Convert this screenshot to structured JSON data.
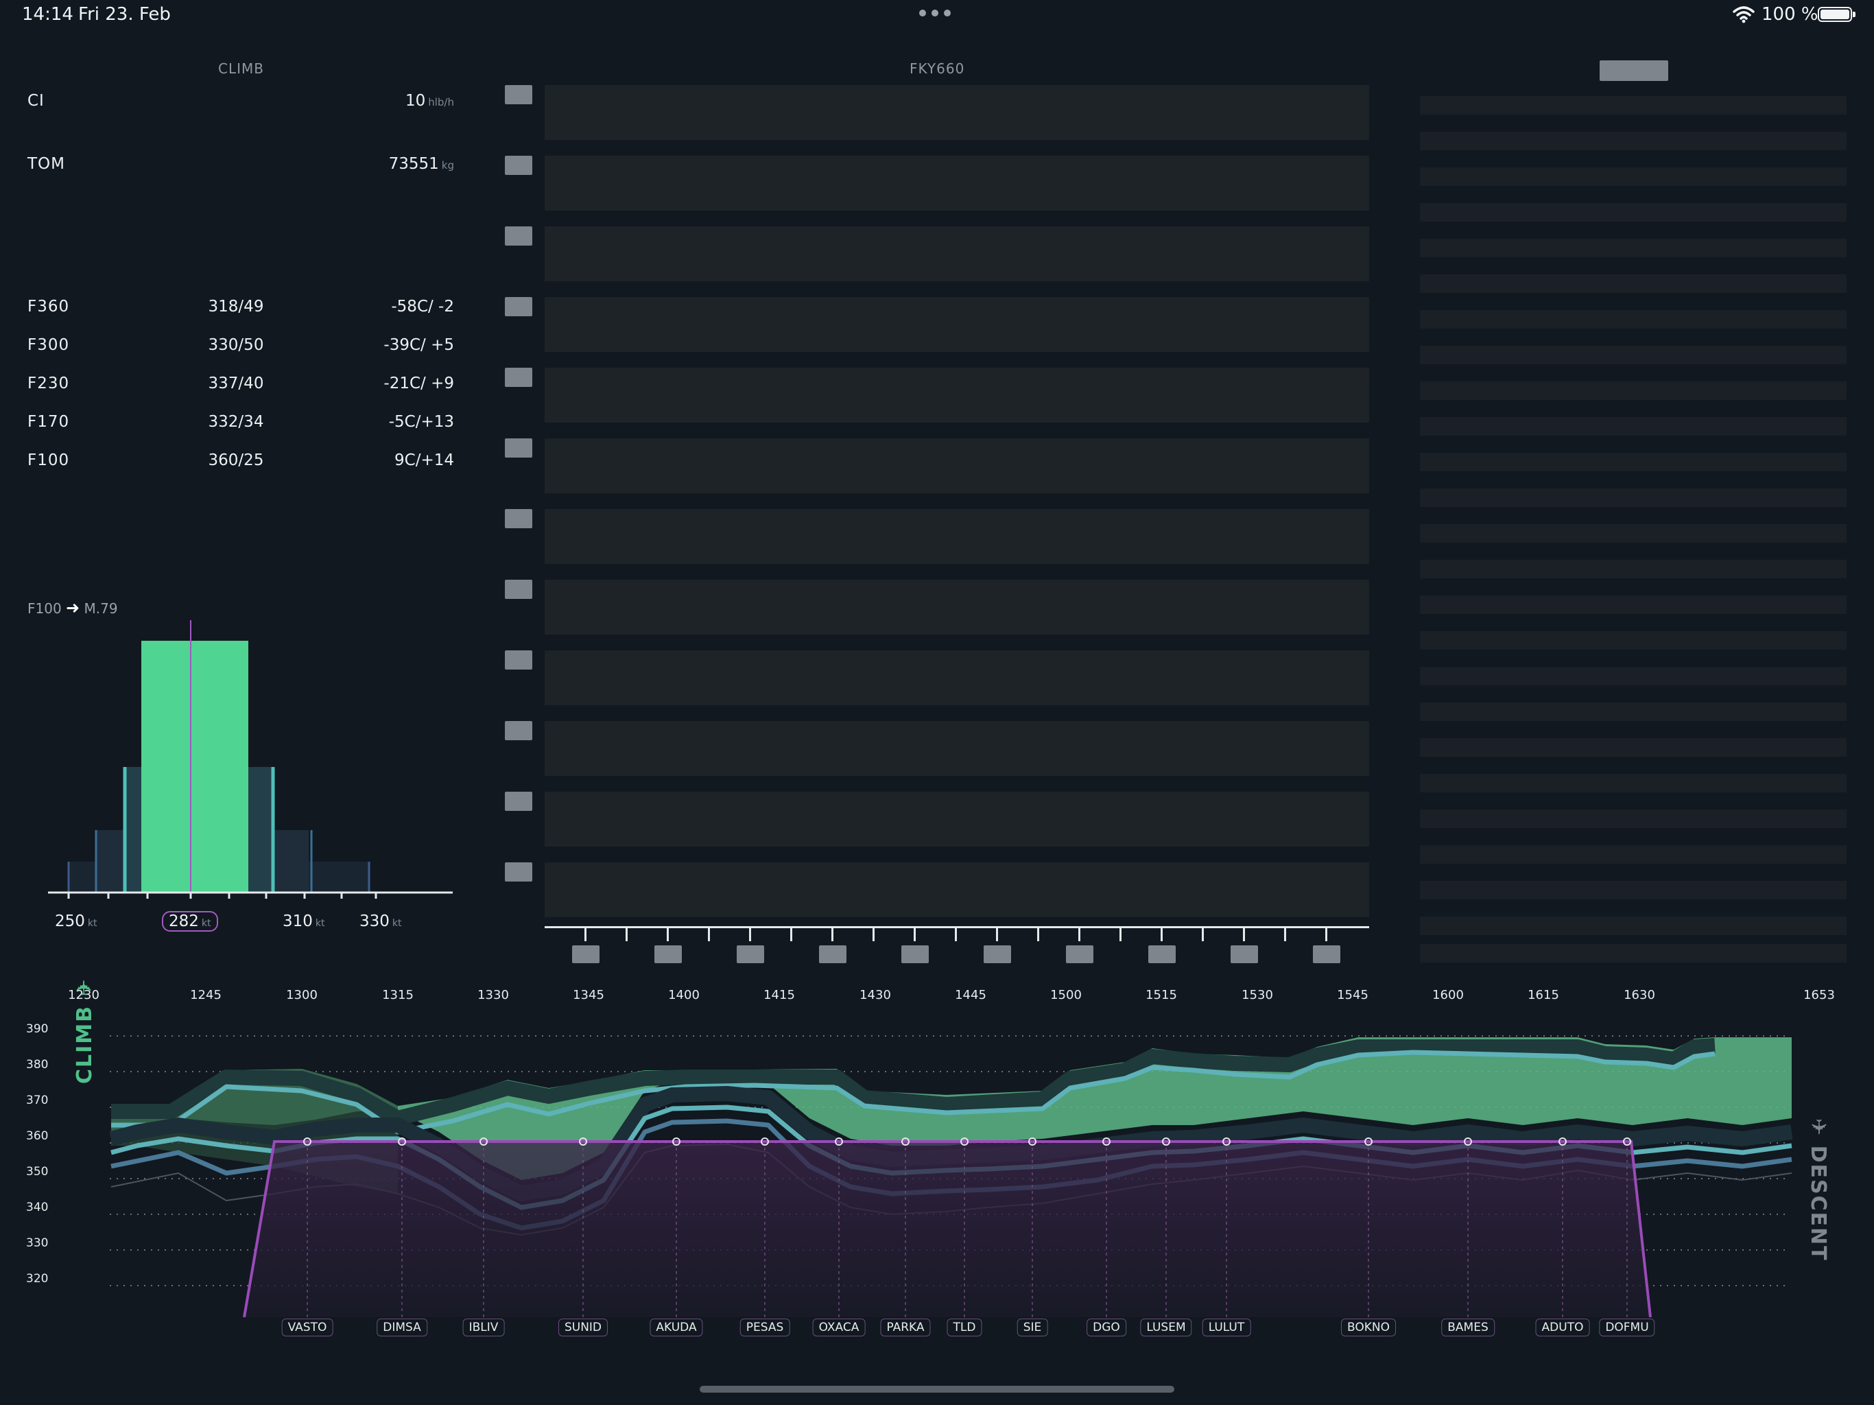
{
  "status_bar": {
    "time": "14:14",
    "date": "Fri 23. Feb",
    "battery": "100 %"
  },
  "climb_panel": {
    "title": "CLIMB",
    "ci": {
      "label": "CI",
      "value": "10",
      "unit": "hlb/h"
    },
    "tom": {
      "label": "TOM",
      "value": "73551",
      "unit": "kg"
    },
    "levels": [
      {
        "fl": "F360",
        "wind": "318/49",
        "temp": "-58C/  -2"
      },
      {
        "fl": "F300",
        "wind": "330/50",
        "temp": "-39C/  +5"
      },
      {
        "fl": "F230",
        "wind": "337/40",
        "temp": "-21C/  +9"
      },
      {
        "fl": "F170",
        "wind": "332/34",
        "temp": "-5C/+13"
      },
      {
        "fl": "F100",
        "wind": "360/25",
        "temp": "9C/+14"
      }
    ],
    "speed_chart": {
      "header_from": "F100",
      "header_to": "M.79",
      "speed_labels": [
        {
          "value": "250",
          "unit": "kt"
        },
        {
          "value": "282",
          "unit": "kt",
          "selected": true
        },
        {
          "value": "310",
          "unit": "kt"
        },
        {
          "value": "330",
          "unit": "kt"
        }
      ]
    }
  },
  "center_panel": {
    "title": "FKY660"
  },
  "timeline": {
    "times": [
      "1230",
      "1245",
      "1300",
      "1315",
      "1330",
      "1345",
      "1400",
      "1415",
      "1430",
      "1445",
      "1500",
      "1515",
      "1530",
      "1545",
      "1600",
      "1615",
      "1630",
      "1653"
    ],
    "flight_levels": [
      "390",
      "380",
      "370",
      "360",
      "350",
      "340",
      "330",
      "320"
    ],
    "climb_label": "CLIMB",
    "descent_label": "DESCENT",
    "waypoints": [
      "VASTO",
      "DIMSA",
      "IBLIV",
      "SUNID",
      "AKUDA",
      "PESAS",
      "OXACA",
      "PARKA",
      "TLD",
      "SIE",
      "DGO",
      "LUSEM",
      "LULUT",
      "BOKNO",
      "BAMES",
      "ADUTO",
      "DOFMU"
    ],
    "colors": {
      "green": "#4fd491",
      "teal": "#5eb2b8",
      "purple": "#9a4bb8"
    }
  }
}
